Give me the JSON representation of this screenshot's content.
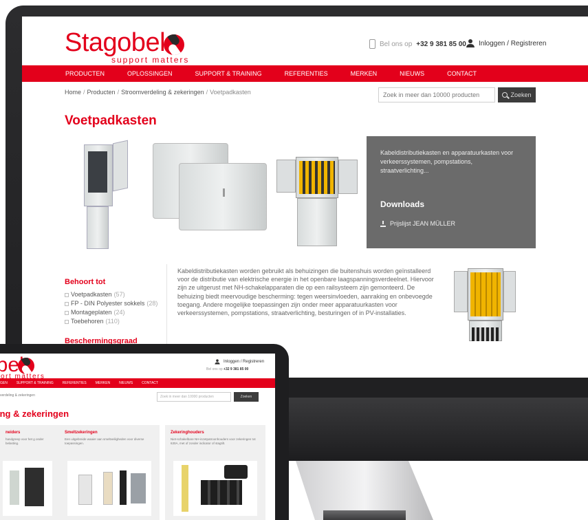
{
  "site": {
    "logo": "Stagobel",
    "tagline": "support matters",
    "phone_label": "Bel ons op",
    "phone_number": "+32 9 381 85 00",
    "login": "Inloggen / Registreren",
    "nav": [
      "PRODUCTEN",
      "OPLOSSINGEN",
      "SUPPORT & TRAINING",
      "REFERENTIES",
      "MERKEN",
      "NIEUWS",
      "CONTACT"
    ],
    "breadcrumb": [
      "Home",
      "Producten",
      "Stroomverdeling & zekeringen",
      "Voetpadkasten"
    ],
    "search_placeholder": "Zoek in meer dan 10000 producten",
    "search_button": "Zoeken",
    "colors": {
      "brand": "#e3001b",
      "panel": "#6b6b6b",
      "dark": "#3c3c3c"
    }
  },
  "product": {
    "title": "Voetpadkasten",
    "info_description": "Kabeldistributiekasten en apparatuurkasten voor verkeerssystemen, pompstations, straatverlichting...",
    "downloads_title": "Downloads",
    "download_item": "Prijslijst JEAN MÜLLER",
    "body": "Kabeldistributiekasten worden gebruikt als behuizingen die buitenshuis worden geïnstalleerd voor de distributie van elektrische energie in het openbare laagspanningsverdeelnet. Hiervoor zijn ze uitgerust met NH-schakelapparaten die op een railsysteem zijn gemonteerd. De behuizing biedt meervoudige bescherming: tegen weersinvloeden, aanraking en onbevoegde toegang. Andere mogelijke toepassingen zijn onder meer apparatuurkasten voor verkeerssystemen, pompstations, straatverlichting, besturingen of in PV-installaties."
  },
  "sidebar": {
    "heading": "Behoort tot",
    "filters": [
      {
        "label": "Voetpadkasten",
        "count": "(57)"
      },
      {
        "label": "FP - DIN Polyester sokkels",
        "count": "(28)"
      },
      {
        "label": "Montageplaten",
        "count": "(24)"
      },
      {
        "label": "Toebehoren",
        "count": "(110)"
      }
    ],
    "heading2": "Beschermingsgraad"
  },
  "laptop": {
    "logo": "obel",
    "tagline": "port matters",
    "login": "Inloggen / Registreren",
    "phone_label": "Bel ons op",
    "phone_number": "+32 9 381 85 00",
    "nav": [
      "GEN",
      "SUPPORT & TRAINING",
      "REFERENTIES",
      "MERKEN",
      "NIEUWS",
      "CONTACT"
    ],
    "breadcrumb": "verdeling & zekeringen",
    "search_placeholder": "Zoek in meer dan 10000 producten",
    "search_button": "Zoeken",
    "title": "ing & zekeringen",
    "cards": [
      {
        "title": "neiders",
        "text": "handgreep voor het g onder belasting."
      },
      {
        "title": "Smeltzekeringen",
        "text": "Een uitgebreide waaier aan smeltveiligheden voor diverse toepassingen."
      },
      {
        "title": "Zekeringhouders",
        "text": "Niet-schakelbare NH-inzetpatroonhouders voor zekeringen tot 630A, met of zonder indicator of stagtilt."
      }
    ]
  }
}
